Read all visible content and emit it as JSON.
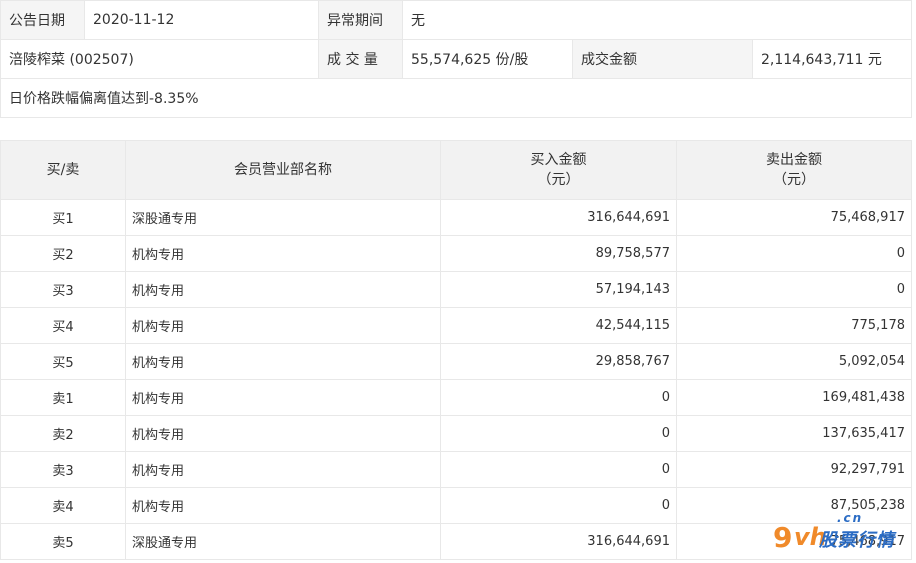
{
  "info": {
    "announce_date_label": "公告日期",
    "announce_date": "2020-11-12",
    "abnormal_period_label": "异常期间",
    "abnormal_period": "无",
    "stock_name": "涪陵榨菜 (002507)",
    "volume_label": "成 交 量",
    "volume": "55,574,625 份/股",
    "turnover_label": "成交金额",
    "turnover": "2,114,643,711 元",
    "reason": "日价格跌幅偏离值达到-8.35%"
  },
  "table": {
    "headers": {
      "side": "买/卖",
      "broker": "会员营业部名称",
      "buy_line1": "买入金额",
      "buy_line2": "（元）",
      "sell_line1": "卖出金额",
      "sell_line2": "（元）"
    },
    "rows": [
      {
        "side": "买1",
        "broker": "深股通专用",
        "buy": "316,644,691",
        "sell": "75,468,917"
      },
      {
        "side": "买2",
        "broker": "机构专用",
        "buy": "89,758,577",
        "sell": "0"
      },
      {
        "side": "买3",
        "broker": "机构专用",
        "buy": "57,194,143",
        "sell": "0"
      },
      {
        "side": "买4",
        "broker": "机构专用",
        "buy": "42,544,115",
        "sell": "775,178"
      },
      {
        "side": "买5",
        "broker": "机构专用",
        "buy": "29,858,767",
        "sell": "5,092,054"
      },
      {
        "side": "卖1",
        "broker": "机构专用",
        "buy": "0",
        "sell": "169,481,438"
      },
      {
        "side": "卖2",
        "broker": "机构专用",
        "buy": "0",
        "sell": "137,635,417"
      },
      {
        "side": "卖3",
        "broker": "机构专用",
        "buy": "0",
        "sell": "92,297,791"
      },
      {
        "side": "卖4",
        "broker": "机构专用",
        "buy": "0",
        "sell": "87,505,238"
      },
      {
        "side": "卖5",
        "broker": "深股通专用",
        "buy": "316,644,691",
        "sell": "75,468,917"
      }
    ]
  },
  "watermark": {
    "brand": "9vh",
    "domain": ".cn",
    "text": "股票行情"
  }
}
